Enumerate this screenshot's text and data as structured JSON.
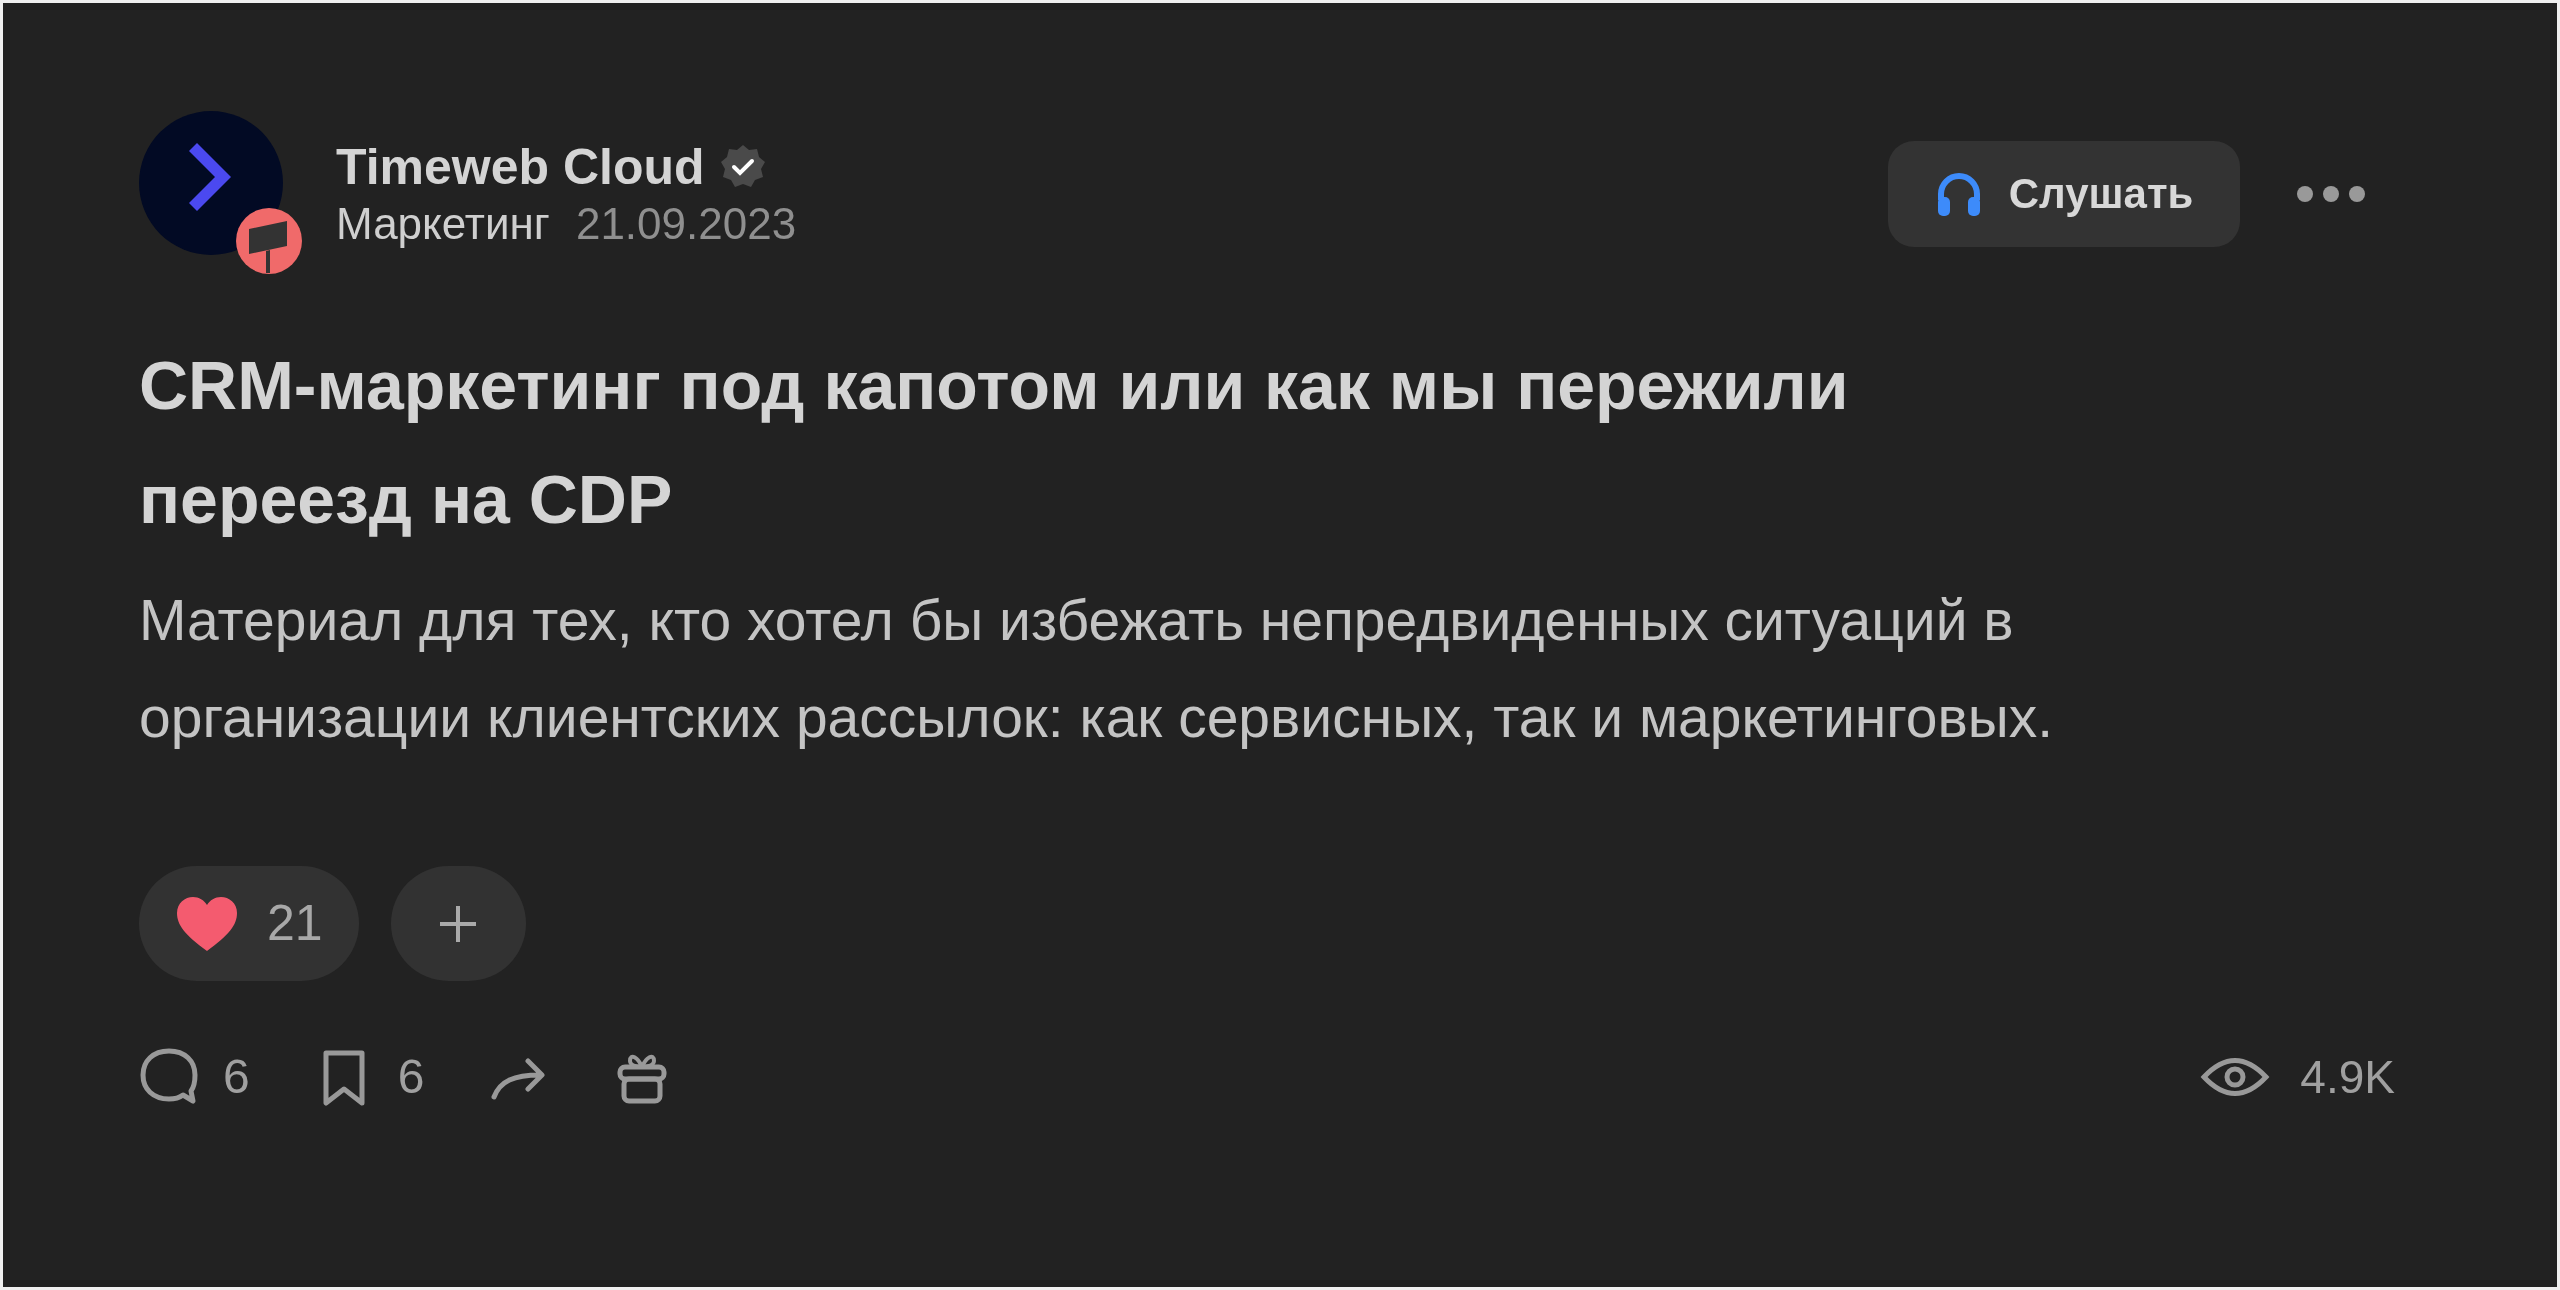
{
  "author": {
    "name": "Timeweb Cloud",
    "verified": true,
    "category": "Маркетинг",
    "date": "21.09.2023"
  },
  "listen_button": {
    "label": "Слушать"
  },
  "title": "CRM-маркетинг под капотом или как мы пережили переезд на CDP",
  "lead": "Материал для тех, кто хотел бы избежать непредвиденных ситуаций в организации клиентских рассылок: как сервисных, так и маркетинговых.",
  "reactions": [
    {
      "kind": "heart",
      "count": "21"
    },
    {
      "kind": "add"
    }
  ],
  "actions": [
    {
      "kind": "comment",
      "count": "6"
    },
    {
      "kind": "bookmark",
      "count": "6"
    },
    {
      "kind": "share"
    },
    {
      "kind": "gift"
    }
  ],
  "views": "4.9K"
}
